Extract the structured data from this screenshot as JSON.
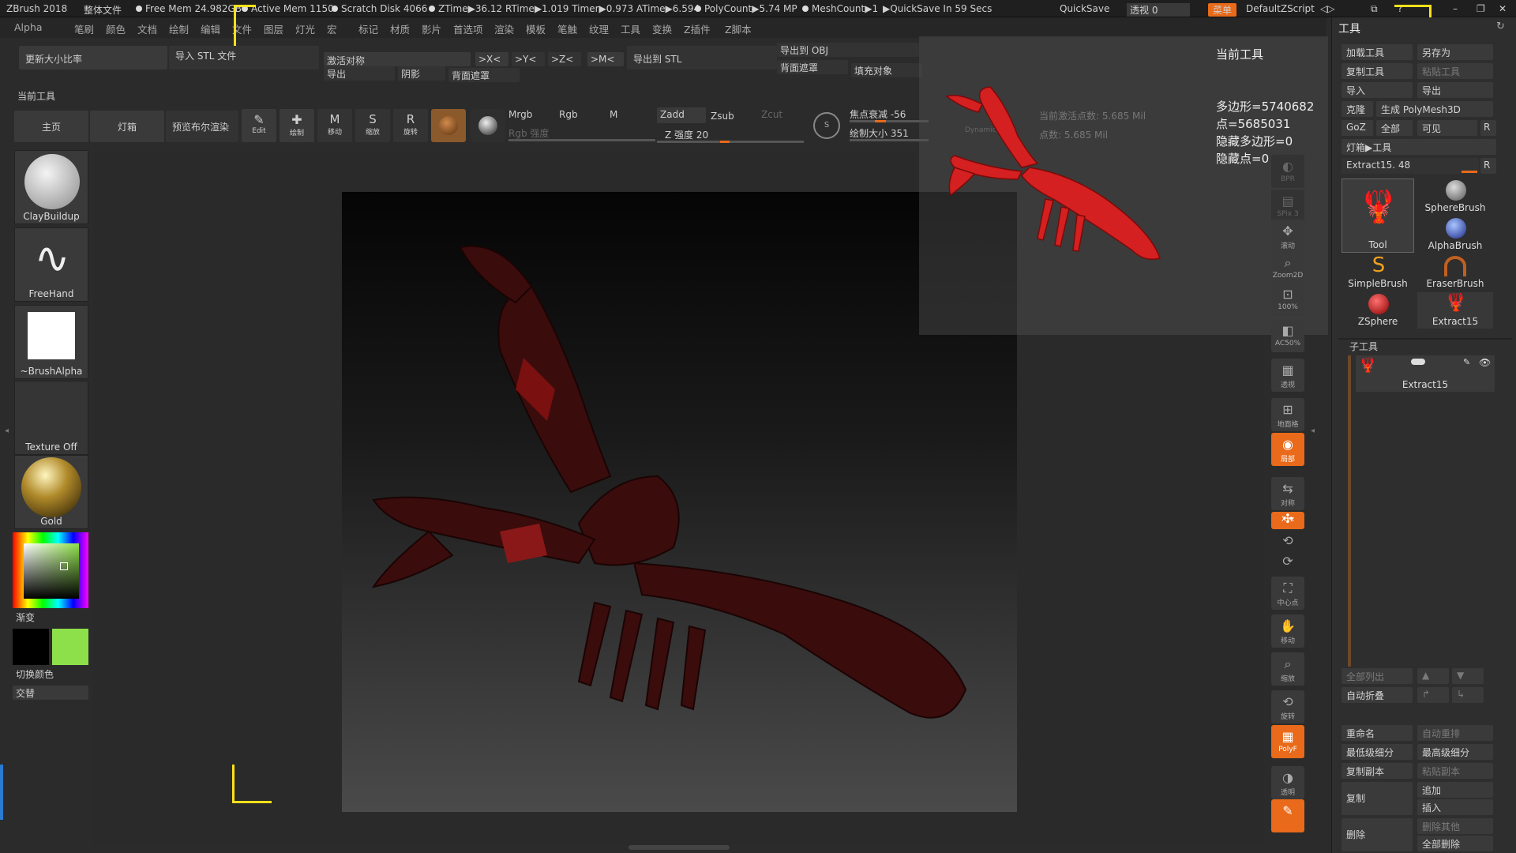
{
  "titlebar": {
    "app": "ZBrush 2018",
    "doc": "整体文件",
    "free_mem": "Free Mem 24.982GB",
    "active_mem": "Active Mem 1150",
    "scratch": "Scratch Disk 4066",
    "ztime": "ZTime▶36.12 RTime▶1.019 Timer▶0.973 ATime▶6.594",
    "polycount": "PolyCount▶5.74 MP",
    "meshcount": "MeshCount▶1",
    "quicksave_timer": "▶QuickSave In 59 Secs",
    "quicksave": "QuickSave",
    "transparency": "透视 0",
    "menu_btn": "菜单",
    "script": "DefaultZScript"
  },
  "menubar": {
    "items": [
      "Alpha",
      "笔刷",
      "颜色",
      "文档",
      "绘制",
      "编辑",
      "文件",
      "图层",
      "灯光",
      "宏",
      "标记",
      "材质",
      "影片",
      "首选项",
      "渲染",
      "模板",
      "笔触",
      "纹理",
      "工具",
      "变换",
      "Z插件",
      "Z脚本"
    ]
  },
  "toolbar": {
    "update_ratio": "更新大小比率",
    "import_stl": "导入 STL 文件",
    "activate_symmetry": "激活对称",
    "sym_x": ">X<",
    "sym_y": ">Y<",
    "sym_z": ">Z<",
    "sym_m": ">M<",
    "export_stl": "导出到 STL",
    "export_obj": "导出到 OBJ",
    "export": "导出",
    "shadow": "阴影",
    "back_mask": "背面遮罩",
    "back_mask2": "背面遮罩",
    "fill_object": "填充对象",
    "current_tool_label": "当前工具",
    "home": "主页",
    "lightbox": "灯箱",
    "preview_bpr": "预览布尔渲染",
    "edit": "Edit",
    "draw": "绘制",
    "move": "移动",
    "scale": "缩放",
    "rotate": "旋转",
    "mrgb": "Mrgb",
    "rgb": "Rgb",
    "m": "M",
    "rgb_intensity": "Rgb 强度",
    "zadd": "Zadd",
    "zsub": "Zsub",
    "zcut": "Zcut",
    "z_intensity": "Z 强度 20",
    "focal_shift": "焦点衰减 -56",
    "draw_size": "绘制大小 351",
    "dynamic": "Dynamic"
  },
  "left": {
    "brush": "ClayBuildup",
    "stroke": "FreeHand",
    "alpha": "~BrushAlpha",
    "texture": "Texture Off",
    "material": "Gold",
    "gradient": "渐变",
    "switch_color": "切换颜色",
    "alternate": "交替",
    "colors": {
      "primary": "#000000",
      "secondary": "#8ee04a",
      "accent": "#e86a1a"
    }
  },
  "popup": {
    "title": "当前工具",
    "polys": "多边形=5740682",
    "points": "点=5685031",
    "hidden_polys": "隐藏多边形=0",
    "hidden_points": "隐藏点=0",
    "faded1": "当前激活点数: 5.685 Mil",
    "faded2": "点数: 5.685 Mil"
  },
  "shelf": {
    "items": [
      "BPR",
      "SPix 3",
      "滚动",
      "Zoom2D",
      "100%",
      "AC50%",
      "透视",
      "地面格",
      "局部",
      "对称",
      "Xyz",
      "",
      "",
      "中心点",
      "移动",
      "缩放",
      "旋转",
      "PolyF",
      "透明",
      ""
    ]
  },
  "right": {
    "header": "工具",
    "load_tool": "加载工具",
    "save_as": "另存为",
    "copy_tool": "复制工具",
    "paste_tool": "粘贴工具",
    "import": "导入",
    "export": "导出",
    "clone": "克隆",
    "make_polymesh": "生成 PolyMesh3D",
    "goz": "GoZ",
    "all": "全部",
    "visible": "可见",
    "r": "R",
    "lightbox_tools": "灯箱▶工具",
    "extract_slider": "Extract15. 48",
    "tools": [
      "Tool",
      "SphereBrush",
      "AlphaBrush",
      "SimpleBrush",
      "EraserBrush",
      "ZSphere",
      "Extract15"
    ],
    "subtool_header": "子工具",
    "subtool_name": "Extract15",
    "list_all": "全部列出",
    "auto_collapse": "自动折叠",
    "rename": "重命名",
    "auto_reorder": "自动重排",
    "lowest_sub": "最低级细分",
    "highest_sub": "最高级细分",
    "duplicate_copy": "复制副本",
    "merge_copy": "粘贴副本",
    "duplicate": "复制",
    "append": "追加",
    "insert": "插入",
    "delete": "删除",
    "delete_other": "删除其他",
    "delete_all": "全部删除"
  }
}
